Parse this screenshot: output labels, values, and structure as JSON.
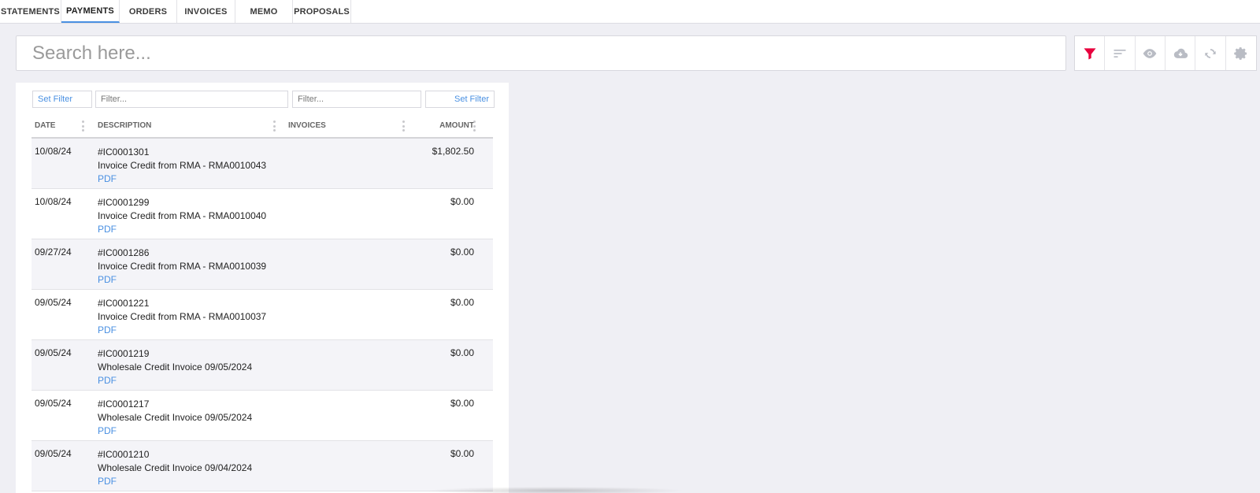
{
  "tabs": [
    {
      "label": "STATEMENTS",
      "active": false
    },
    {
      "label": "PAYMENTS",
      "active": true
    },
    {
      "label": "ORDERS",
      "active": false
    },
    {
      "label": "INVOICES",
      "active": false
    },
    {
      "label": "MEMO",
      "active": false
    },
    {
      "label": "PROPOSALS",
      "active": false
    }
  ],
  "search": {
    "placeholder": "Search here...",
    "value": ""
  },
  "toolbar": {
    "icons": [
      "filter-icon",
      "sort-icon",
      "eye-icon",
      "cloud-download-icon",
      "sync-icon",
      "gear-icon"
    ],
    "active_color": "#e8003d",
    "icon_color": "#b9bcc4"
  },
  "filters": {
    "date_set_filter": "Set Filter",
    "description_placeholder": "Filter...",
    "invoices_placeholder": "Filter...",
    "amount_set_filter": "Set Filter"
  },
  "grid": {
    "columns": {
      "date": "DATE",
      "description": "DESCRIPTION",
      "invoices": "INVOICES",
      "amount": "AMOUNT"
    },
    "rows": [
      {
        "date": "10/08/24",
        "number": "#IC0001301",
        "text": "Invoice Credit from RMA - RMA0010043",
        "link": "PDF",
        "amount": "$1,802.50"
      },
      {
        "date": "10/08/24",
        "number": "#IC0001299",
        "text": "Invoice Credit from RMA - RMA0010040",
        "link": "PDF",
        "amount": "$0.00"
      },
      {
        "date": "09/27/24",
        "number": "#IC0001286",
        "text": "Invoice Credit from RMA - RMA0010039",
        "link": "PDF",
        "amount": "$0.00"
      },
      {
        "date": "09/05/24",
        "number": "#IC0001221",
        "text": "Invoice Credit from RMA - RMA0010037",
        "link": "PDF",
        "amount": "$0.00"
      },
      {
        "date": "09/05/24",
        "number": "#IC0001219",
        "text": "Wholesale Credit Invoice 09/05/2024",
        "link": "PDF",
        "amount": "$0.00"
      },
      {
        "date": "09/05/24",
        "number": "#IC0001217",
        "text": "Wholesale Credit Invoice 09/05/2024",
        "link": "PDF",
        "amount": "$0.00"
      },
      {
        "date": "09/05/24",
        "number": "#IC0001210",
        "text": "Wholesale Credit Invoice 09/04/2024",
        "link": "PDF",
        "amount": "$0.00"
      }
    ]
  },
  "colors": {
    "accent": "#4a90e2",
    "background": "#efeff4"
  }
}
